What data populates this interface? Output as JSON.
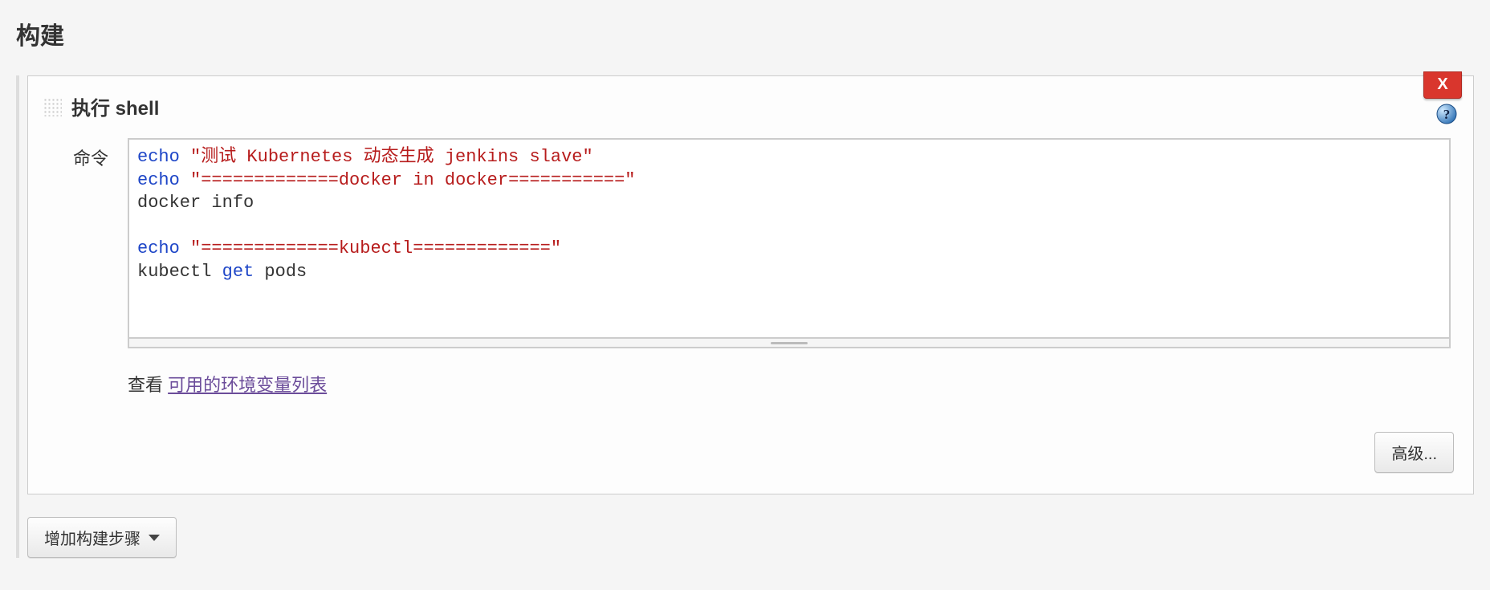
{
  "section": {
    "title": "构建"
  },
  "builder": {
    "title": "执行 shell",
    "delete_label": "X",
    "form": {
      "command_label": "命令",
      "command_tokens": [
        {
          "t": "kw",
          "v": "echo"
        },
        {
          "t": "sp",
          "v": " "
        },
        {
          "t": "str",
          "v": "\"测试 Kubernetes 动态生成 jenkins slave\""
        },
        {
          "t": "nl"
        },
        {
          "t": "kw",
          "v": "echo"
        },
        {
          "t": "sp",
          "v": " "
        },
        {
          "t": "str",
          "v": "\"=============docker in docker===========\""
        },
        {
          "t": "nl"
        },
        {
          "t": "txt",
          "v": "docker info"
        },
        {
          "t": "nl"
        },
        {
          "t": "nl"
        },
        {
          "t": "kw",
          "v": "echo"
        },
        {
          "t": "sp",
          "v": " "
        },
        {
          "t": "str",
          "v": "\"=============kubectl=============\""
        },
        {
          "t": "nl"
        },
        {
          "t": "txt",
          "v": "kubectl "
        },
        {
          "t": "get",
          "v": "get"
        },
        {
          "t": "txt",
          "v": " pods"
        }
      ],
      "hint_prefix": "查看 ",
      "hint_link": "可用的环境变量列表"
    },
    "advanced_label": "高级..."
  },
  "add_step_label": "增加构建步骤"
}
